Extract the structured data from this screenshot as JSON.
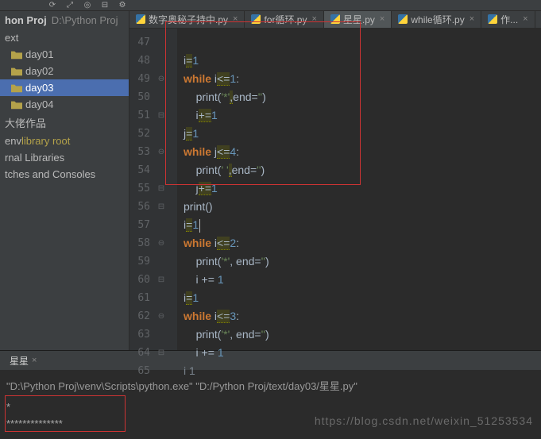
{
  "toolbar": {
    "icons": [
      "refresh",
      "expand",
      "target",
      "collapse",
      "settings"
    ]
  },
  "project": {
    "rootName": "hon Proj",
    "rootPath": "D:\\Python Proj",
    "items": [
      {
        "label": "ext",
        "indent": 0
      },
      {
        "label": "day01",
        "indent": 1
      },
      {
        "label": "day02",
        "indent": 1
      },
      {
        "label": "day03",
        "indent": 1,
        "selected": true
      },
      {
        "label": "day04",
        "indent": 1
      },
      {
        "label": "大佬作品",
        "indent": 0
      },
      {
        "label": "env",
        "lib": "library root",
        "indent": 0
      },
      {
        "label": "rnal Libraries",
        "indent": 0
      },
      {
        "label": "tches and Consoles",
        "indent": 0
      }
    ]
  },
  "tabs": [
    {
      "label": "数字奥秘子持中.py",
      "active": false
    },
    {
      "label": "for循环.py",
      "active": false
    },
    {
      "label": "星星.py",
      "active": true
    },
    {
      "label": "while循环.py",
      "active": false
    },
    {
      "label": "作...",
      "active": false
    }
  ],
  "code": {
    "lines": [
      {
        "n": "47",
        "fold": "",
        "html": ""
      },
      {
        "n": "48",
        "fold": "",
        "html": "i<span class='warn op'>=</span><span class='num'>1</span>"
      },
      {
        "n": "49",
        "fold": "⊖",
        "html": "<span class='kw'>while</span> i<span class='warn op'>&lt;=</span><span class='num'>1</span><span class='op'>:</span>"
      },
      {
        "n": "50",
        "fold": "",
        "html": "    <span class='fn'>print</span>(<span class='str'>'*'</span><span class='warn op'>,</span><span class='fn'>end</span>=<span class='str'>''</span>)"
      },
      {
        "n": "51",
        "fold": "⊟",
        "html": "    i<span class='warn op'>+=</span><span class='num'>1</span>"
      },
      {
        "n": "52",
        "fold": "",
        "html": "j<span class='warn op'>=</span><span class='num'>1</span>"
      },
      {
        "n": "53",
        "fold": "⊖",
        "html": "<span class='kw'>while</span> j<span class='warn op'>&lt;=</span><span class='num'>4</span><span class='op'>:</span>"
      },
      {
        "n": "54",
        "fold": "",
        "html": "    <span class='fn'>print</span>(<span class='str'>' '</span><span class='warn op'>,</span><span class='fn'>end</span>=<span class='str'>''</span>)"
      },
      {
        "n": "55",
        "fold": "⊟",
        "html": "    j<span class='warn op'>+=</span><span class='num'>1</span>"
      },
      {
        "n": "56",
        "fold": "⊟",
        "html": "<span class='fn'>print</span>()"
      },
      {
        "n": "57",
        "fold": "",
        "html": "i<span class='warn op'>=</span><span class='num'>1</span><span class='caret'></span>"
      },
      {
        "n": "58",
        "fold": "⊖",
        "html": "<span class='kw'>while</span> i<span class='warn op'>&lt;=</span><span class='num'>2</span><span class='op'>:</span>"
      },
      {
        "n": "59",
        "fold": "",
        "html": "    <span class='fn'>print</span>(<span class='str'>'*'</span>, <span class='fn'>end</span>=<span class='str'>''</span>)"
      },
      {
        "n": "60",
        "fold": "⊟",
        "html": "    i += <span class='num'>1</span>"
      },
      {
        "n": "61",
        "fold": "",
        "html": "i<span class='warn op'>=</span><span class='num'>1</span>"
      },
      {
        "n": "62",
        "fold": "⊖",
        "html": "<span class='kw'>while</span> i<span class='warn op'>&lt;=</span><span class='num'>3</span><span class='op'>:</span>"
      },
      {
        "n": "63",
        "fold": "",
        "html": "    <span class='fn'>print</span>(<span class='str'>'*'</span>, <span class='fn'>end</span>=<span class='str'>''</span>)"
      },
      {
        "n": "64",
        "fold": "⊟",
        "html": "    i += <span class='num'>1</span>"
      },
      {
        "n": "65",
        "fold": "",
        "html": "<span style='opacity:.6'>i 1</span>"
      }
    ]
  },
  "run": {
    "tabLabel": "星星",
    "cmd": "\"D:\\Python Proj\\venv\\Scripts\\python.exe\" \"D:/Python Proj/text/day03/星星.py\"",
    "out1": "*",
    "out2": "**************"
  },
  "watermark": "https://blog.csdn.net/weixin_51253534"
}
